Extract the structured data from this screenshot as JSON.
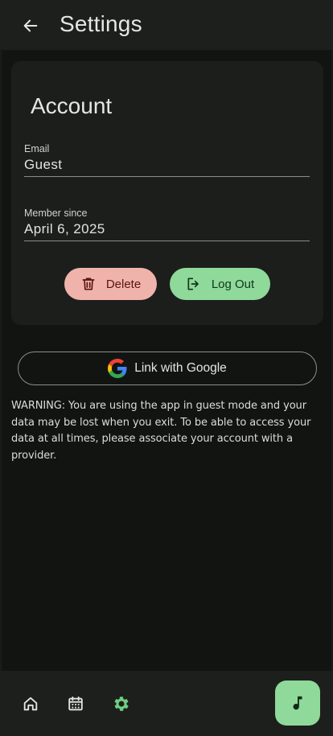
{
  "appbar": {
    "title": "Settings",
    "back_icon": "arrow-left-icon"
  },
  "account": {
    "title": "Account",
    "email": {
      "label": "Email",
      "value": "Guest"
    },
    "member_since": {
      "label": "Member since",
      "value": "April 6, 2025"
    },
    "delete_label": "Delete",
    "logout_label": "Log Out"
  },
  "link_google": {
    "label": "Link with Google",
    "icon": "google-icon"
  },
  "warning_text": "WARNING: You are using the app in guest mode and your data may be lost when you exit. To be able to access your data at all times, please associate your account with a provider.",
  "bottom_nav": {
    "items": [
      {
        "icon": "home-icon",
        "active": false
      },
      {
        "icon": "calendar-icon",
        "active": false
      },
      {
        "icon": "gear-icon",
        "active": true
      }
    ],
    "fab_icon": "music-note-icon"
  },
  "colors": {
    "accent_green": "#8fd99a",
    "delete_pink": "#f0b3ab",
    "surface": "#1c1e1c",
    "background": "#121412"
  }
}
